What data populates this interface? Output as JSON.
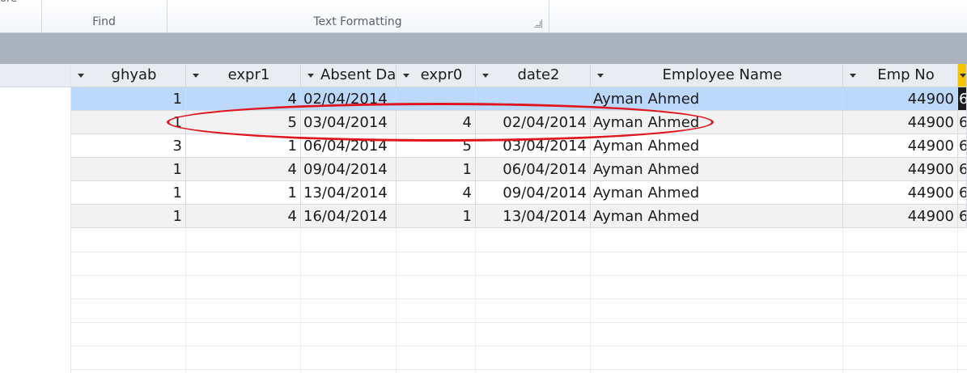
{
  "ribbon": {
    "partial_label": "ore",
    "groups": [
      {
        "label": "Find"
      },
      {
        "label": "Text Formatting"
      }
    ]
  },
  "grid": {
    "columns": [
      {
        "label": "ghyab"
      },
      {
        "label": "expr1"
      },
      {
        "label": "Absent Da"
      },
      {
        "label": "expr0"
      },
      {
        "label": "date2"
      },
      {
        "label": "Employee Name"
      },
      {
        "label": "Emp No"
      },
      {
        "label": ""
      }
    ],
    "rows": [
      {
        "ghyab": "1",
        "expr1": "4",
        "absent": "02/04/2014",
        "expr0": "",
        "date2": "",
        "name": "Ayman Ahmed",
        "empno": "44900",
        "extra": "6"
      },
      {
        "ghyab": "1",
        "expr1": "5",
        "absent": "03/04/2014",
        "expr0": "4",
        "date2": "02/04/2014",
        "name": "Ayman Ahmed",
        "empno": "44900",
        "extra": "6"
      },
      {
        "ghyab": "3",
        "expr1": "1",
        "absent": "06/04/2014",
        "expr0": "5",
        "date2": "03/04/2014",
        "name": "Ayman Ahmed",
        "empno": "44900",
        "extra": "6"
      },
      {
        "ghyab": "1",
        "expr1": "4",
        "absent": "09/04/2014",
        "expr0": "1",
        "date2": "06/04/2014",
        "name": "Ayman Ahmed",
        "empno": "44900",
        "extra": "6"
      },
      {
        "ghyab": "1",
        "expr1": "1",
        "absent": "13/04/2014",
        "expr0": "4",
        "date2": "09/04/2014",
        "name": "Ayman Ahmed",
        "empno": "44900",
        "extra": "6"
      },
      {
        "ghyab": "1",
        "expr1": "4",
        "absent": "16/04/2014",
        "expr0": "1",
        "date2": "13/04/2014",
        "name": "Ayman Ahmed",
        "empno": "44900",
        "extra": "6"
      }
    ]
  },
  "colors": {
    "selected_row": "#bcd9fb",
    "highlight": "#e0161e",
    "active_header": "#f5c400"
  }
}
